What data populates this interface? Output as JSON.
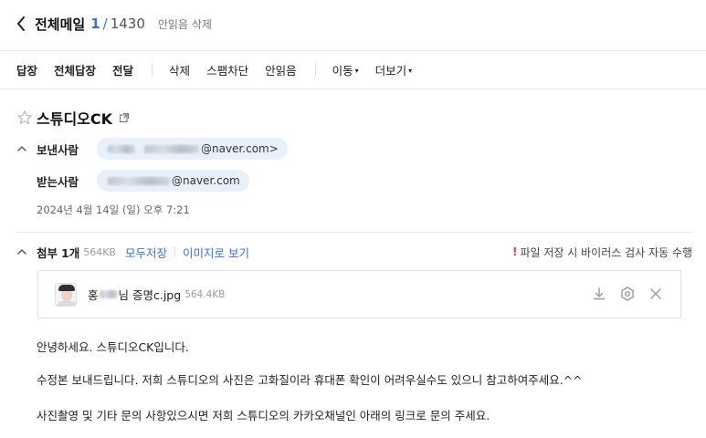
{
  "header": {
    "folder_title": "전체메일",
    "current_index": "1",
    "separator": "/",
    "total_count": "1430",
    "unread_delete_label": "안읽음 삭제"
  },
  "toolbar": {
    "reply": "답장",
    "reply_all": "전체답장",
    "forward": "전달",
    "delete": "삭제",
    "block_spam": "스팸차단",
    "mark_unread": "안읽음",
    "move": "이동",
    "more": "더보기",
    "caret": "▾"
  },
  "message": {
    "subject": "스튜디오CK",
    "sender_label": "보낸사람",
    "sender_address_suffix": "@naver.com>",
    "receiver_label": "받는사람",
    "receiver_address_suffix": "@naver.com",
    "date": "2024년 4월 14일 (일) 오후 7:21"
  },
  "attachments": {
    "label": "첨부",
    "count": "1개",
    "total_size": "564KB",
    "save_all": "모두저장",
    "view_as_image": "이미지로 보기",
    "virus_warning_mark": "!",
    "virus_warning": "파일 저장 시 바이러스 검사 자동 수행",
    "files": [
      {
        "name_prefix": "홍",
        "name_suffix": "님 증명c.jpg",
        "size": "564.4KB"
      }
    ]
  },
  "body": {
    "lines": [
      "안녕하세요. 스튜디오CK입니다.",
      "수정본 보내드립니다. 저희 스튜디오의 사진은 고화질이라 휴대폰 확인이 어려우실수도 있으니 참고하여주세요.^^",
      "사진촬영 및 기타 문의 사항있으시면 저희 스튜디오의 카카오채널인 아래의 링크로 문의 주세요."
    ]
  },
  "icons": {
    "back": "chevron-left-icon",
    "star": "star-outline-icon",
    "popout": "external-window-icon",
    "collapse": "chevron-up-icon",
    "download": "download-icon",
    "virus_scan": "shield-scan-icon",
    "close": "close-icon"
  },
  "colors": {
    "accent": "#3a6fd8",
    "chip_bg": "#e8f0fb",
    "warning": "#e03a3a"
  }
}
